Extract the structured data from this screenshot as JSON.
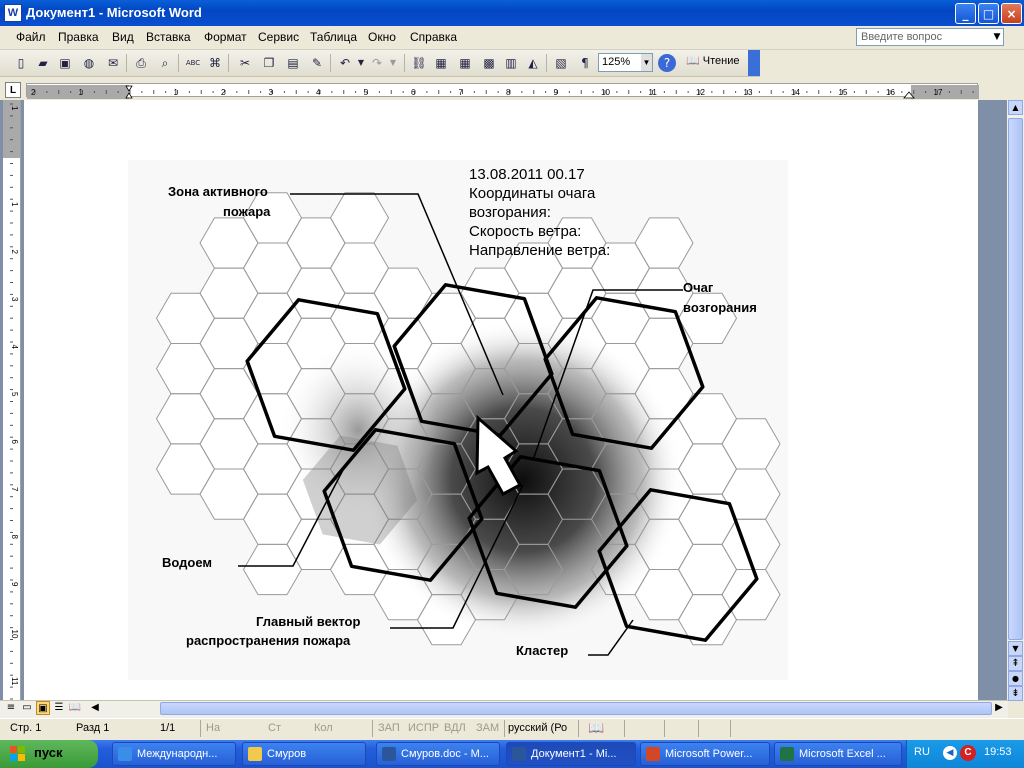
{
  "window": {
    "title": "Документ1 - Microsoft Word",
    "app_icon": "word-icon",
    "controls": {
      "minimize": "_",
      "maximize": "□",
      "close": "×"
    }
  },
  "menu": {
    "items": [
      "Файл",
      "Правка",
      "Вид",
      "Вставка",
      "Формат",
      "Сервис",
      "Таблица",
      "Окно",
      "Справка"
    ],
    "ask_placeholder": "Введите вопрос"
  },
  "toolbar": {
    "zoom": "125%",
    "reading_label": "Чтение",
    "pilcrow": "¶",
    "abc": "ABC"
  },
  "ruler": {
    "tab_marker": "L",
    "numbers": [
      "2",
      "1",
      "1",
      "2",
      "3",
      "4",
      "5",
      "6",
      "7",
      "8",
      "9",
      "10",
      "11",
      "12",
      "13",
      "14",
      "15",
      "16",
      "17"
    ],
    "vnumbers": [
      "1",
      "1",
      "2",
      "3",
      "4",
      "5",
      "6",
      "7",
      "8",
      "9",
      "10",
      "11"
    ]
  },
  "diagram": {
    "info_lines": [
      "13.08.2011  00.17",
      "Координаты очага",
      "возгорания:",
      "Скорость ветра:",
      "Направление ветра:"
    ],
    "label_active_zone": [
      "Зона активного",
      "пожара"
    ],
    "label_focus": [
      "Очаг",
      "возгорания"
    ],
    "label_water": "Водоем",
    "label_vector": [
      "Главный вектор",
      "распространения пожара"
    ],
    "label_cluster": "Кластер"
  },
  "status": {
    "page": "Стр.  1",
    "section": "Разд  1",
    "pages": "1/1",
    "at": "На",
    "line": "Ст",
    "col": "Кол",
    "rec": "ЗАП",
    "trk": "ИСПР",
    "ext": "ВДЛ",
    "ovr": "ЗАМ",
    "language": "русский (Ро"
  },
  "taskbar": {
    "start_label": "пуск",
    "tasks": [
      {
        "label": "Международн...",
        "icon": "ie-icon"
      },
      {
        "label": "Смуров",
        "icon": "folder-icon"
      },
      {
        "label": "Смуров.doc - M...",
        "icon": "word-icon"
      },
      {
        "label": "Документ1 - Mi...",
        "icon": "word-icon",
        "active": true
      },
      {
        "label": "Microsoft Power...",
        "icon": "powerpoint-icon"
      },
      {
        "label": "Microsoft Excel ...",
        "icon": "excel-icon"
      }
    ],
    "lang": "RU",
    "clock": "19:53"
  },
  "colors": {
    "titlebar": "#0a4fd0",
    "taskbar": "#245edb",
    "start": "#3a9a37",
    "tray": "#0f85d8"
  }
}
